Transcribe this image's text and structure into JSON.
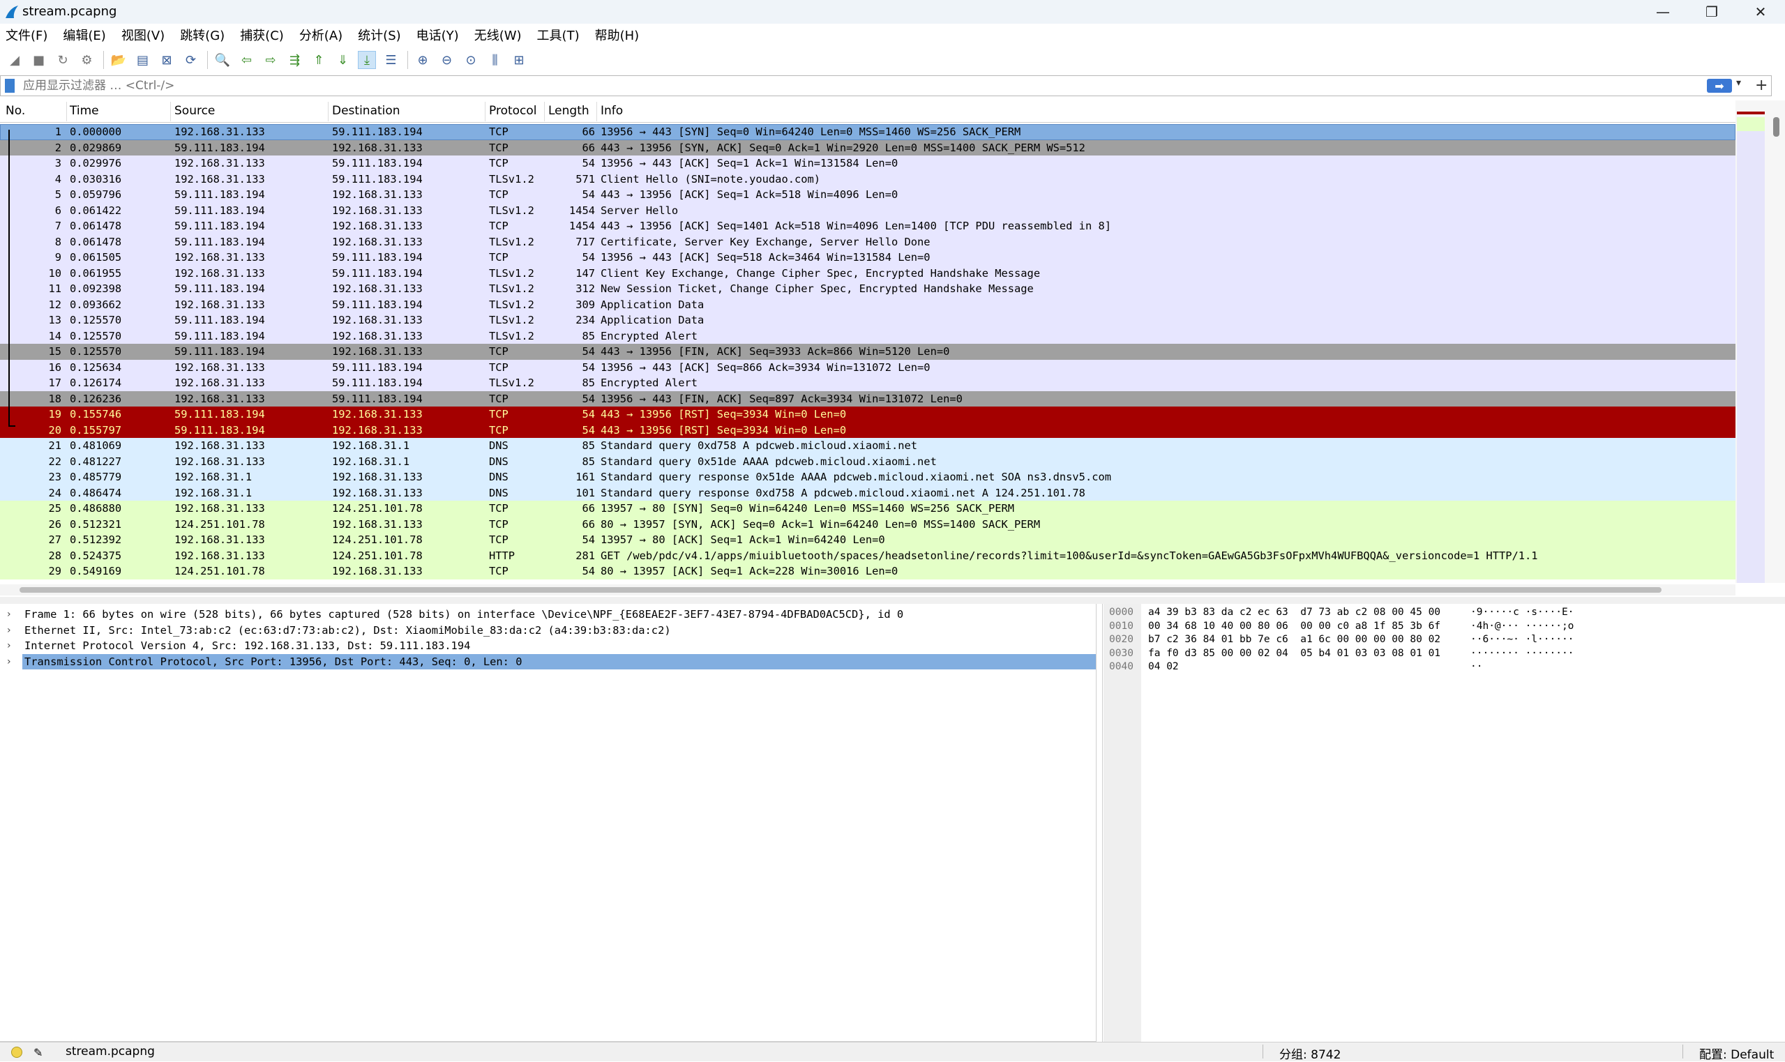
{
  "window": {
    "title": "stream.pcapng",
    "minimize": "—",
    "restore": "❐",
    "close": "✕"
  },
  "menu": [
    "文件(F)",
    "编辑(E)",
    "视图(V)",
    "跳转(G)",
    "捕获(C)",
    "分析(A)",
    "统计(S)",
    "电话(Y)",
    "无线(W)",
    "工具(T)",
    "帮助(H)"
  ],
  "toolbar": [
    {
      "name": "start-capture-icon",
      "glyph": "◢"
    },
    {
      "name": "stop-capture-icon",
      "glyph": "■"
    },
    {
      "name": "restart-capture-icon",
      "glyph": "↻"
    },
    {
      "name": "capture-options-icon",
      "glyph": "⚙"
    },
    {
      "name": "open-file-icon",
      "glyph": "📂"
    },
    {
      "name": "save-file-icon",
      "glyph": "▤"
    },
    {
      "name": "close-file-icon",
      "glyph": "⊠"
    },
    {
      "name": "reload-file-icon",
      "glyph": "⟳"
    },
    {
      "name": "find-packet-icon",
      "glyph": "🔍"
    },
    {
      "name": "go-back-icon",
      "glyph": "⇦"
    },
    {
      "name": "go-forward-icon",
      "glyph": "⇨"
    },
    {
      "name": "go-to-packet-icon",
      "glyph": "⇶"
    },
    {
      "name": "first-packet-icon",
      "glyph": "⇑"
    },
    {
      "name": "last-packet-icon",
      "glyph": "⇓"
    },
    {
      "name": "autoscroll-icon",
      "glyph": "⤓"
    },
    {
      "name": "colorize-icon",
      "glyph": "☰"
    },
    {
      "name": "zoom-in-icon",
      "glyph": "⊕"
    },
    {
      "name": "zoom-out-icon",
      "glyph": "⊖"
    },
    {
      "name": "zoom-reset-icon",
      "glyph": "⊙"
    },
    {
      "name": "resize-columns-icon",
      "glyph": "⫼"
    },
    {
      "name": "layout-icon",
      "glyph": "⊞"
    }
  ],
  "filter": {
    "placeholder": "应用显示过滤器 … <Ctrl-/>",
    "apply_glyph": "➡",
    "dropdown_glyph": "▾",
    "add_glyph": "+"
  },
  "columns": {
    "no": "No.",
    "time": "Time",
    "source": "Source",
    "destination": "Destination",
    "protocol": "Protocol",
    "length": "Length",
    "info": "Info"
  },
  "packets": [
    {
      "no": "1",
      "time": "0.000000",
      "src": "192.168.31.133",
      "dst": "59.111.183.194",
      "proto": "TCP",
      "len": "66",
      "info": "13956 → 443 [SYN] Seq=0 Win=64240 Len=0 MSS=1460 WS=256 SACK_PERM",
      "color": "tcp",
      "selected": true
    },
    {
      "no": "2",
      "time": "0.029869",
      "src": "59.111.183.194",
      "dst": "192.168.31.133",
      "proto": "TCP",
      "len": "66",
      "info": "443 → 13956 [SYN, ACK] Seq=0 Ack=1 Win=2920 Len=0 MSS=1400 SACK_PERM WS=512",
      "color": "grey"
    },
    {
      "no": "3",
      "time": "0.029976",
      "src": "192.168.31.133",
      "dst": "59.111.183.194",
      "proto": "TCP",
      "len": "54",
      "info": "13956 → 443 [ACK] Seq=1 Ack=1 Win=131584 Len=0",
      "color": "tcp"
    },
    {
      "no": "4",
      "time": "0.030316",
      "src": "192.168.31.133",
      "dst": "59.111.183.194",
      "proto": "TLSv1.2",
      "len": "571",
      "info": "Client Hello (SNI=note.youdao.com)",
      "color": "tcp"
    },
    {
      "no": "5",
      "time": "0.059796",
      "src": "59.111.183.194",
      "dst": "192.168.31.133",
      "proto": "TCP",
      "len": "54",
      "info": "443 → 13956 [ACK] Seq=1 Ack=518 Win=4096 Len=0",
      "color": "tcp"
    },
    {
      "no": "6",
      "time": "0.061422",
      "src": "59.111.183.194",
      "dst": "192.168.31.133",
      "proto": "TLSv1.2",
      "len": "1454",
      "info": "Server Hello",
      "color": "tcp"
    },
    {
      "no": "7",
      "time": "0.061478",
      "src": "59.111.183.194",
      "dst": "192.168.31.133",
      "proto": "TCP",
      "len": "1454",
      "info": "443 → 13956 [ACK] Seq=1401 Ack=518 Win=4096 Len=1400 [TCP PDU reassembled in 8]",
      "color": "tcp"
    },
    {
      "no": "8",
      "time": "0.061478",
      "src": "59.111.183.194",
      "dst": "192.168.31.133",
      "proto": "TLSv1.2",
      "len": "717",
      "info": "Certificate, Server Key Exchange, Server Hello Done",
      "color": "tcp"
    },
    {
      "no": "9",
      "time": "0.061505",
      "src": "192.168.31.133",
      "dst": "59.111.183.194",
      "proto": "TCP",
      "len": "54",
      "info": "13956 → 443 [ACK] Seq=518 Ack=3464 Win=131584 Len=0",
      "color": "tcp"
    },
    {
      "no": "10",
      "time": "0.061955",
      "src": "192.168.31.133",
      "dst": "59.111.183.194",
      "proto": "TLSv1.2",
      "len": "147",
      "info": "Client Key Exchange, Change Cipher Spec, Encrypted Handshake Message",
      "color": "tcp"
    },
    {
      "no": "11",
      "time": "0.092398",
      "src": "59.111.183.194",
      "dst": "192.168.31.133",
      "proto": "TLSv1.2",
      "len": "312",
      "info": "New Session Ticket, Change Cipher Spec, Encrypted Handshake Message",
      "color": "tcp"
    },
    {
      "no": "12",
      "time": "0.093662",
      "src": "192.168.31.133",
      "dst": "59.111.183.194",
      "proto": "TLSv1.2",
      "len": "309",
      "info": "Application Data",
      "color": "tcp"
    },
    {
      "no": "13",
      "time": "0.125570",
      "src": "59.111.183.194",
      "dst": "192.168.31.133",
      "proto": "TLSv1.2",
      "len": "234",
      "info": "Application Data",
      "color": "tcp"
    },
    {
      "no": "14",
      "time": "0.125570",
      "src": "59.111.183.194",
      "dst": "192.168.31.133",
      "proto": "TLSv1.2",
      "len": "85",
      "info": "Encrypted Alert",
      "color": "tcp"
    },
    {
      "no": "15",
      "time": "0.125570",
      "src": "59.111.183.194",
      "dst": "192.168.31.133",
      "proto": "TCP",
      "len": "54",
      "info": "443 → 13956 [FIN, ACK] Seq=3933 Ack=866 Win=5120 Len=0",
      "color": "grey"
    },
    {
      "no": "16",
      "time": "0.125634",
      "src": "192.168.31.133",
      "dst": "59.111.183.194",
      "proto": "TCP",
      "len": "54",
      "info": "13956 → 443 [ACK] Seq=866 Ack=3934 Win=131072 Len=0",
      "color": "tcp"
    },
    {
      "no": "17",
      "time": "0.126174",
      "src": "192.168.31.133",
      "dst": "59.111.183.194",
      "proto": "TLSv1.2",
      "len": "85",
      "info": "Encrypted Alert",
      "color": "tcp"
    },
    {
      "no": "18",
      "time": "0.126236",
      "src": "192.168.31.133",
      "dst": "59.111.183.194",
      "proto": "TCP",
      "len": "54",
      "info": "13956 → 443 [FIN, ACK] Seq=897 Ack=3934 Win=131072 Len=0",
      "color": "grey"
    },
    {
      "no": "19",
      "time": "0.155746",
      "src": "59.111.183.194",
      "dst": "192.168.31.133",
      "proto": "TCP",
      "len": "54",
      "info": "443 → 13956 [RST] Seq=3934 Win=0 Len=0",
      "color": "rst"
    },
    {
      "no": "20",
      "time": "0.155797",
      "src": "59.111.183.194",
      "dst": "192.168.31.133",
      "proto": "TCP",
      "len": "54",
      "info": "443 → 13956 [RST] Seq=3934 Win=0 Len=0",
      "color": "rst"
    },
    {
      "no": "21",
      "time": "0.481069",
      "src": "192.168.31.133",
      "dst": "192.168.31.1",
      "proto": "DNS",
      "len": "85",
      "info": "Standard query 0xd758 A pdcweb.micloud.xiaomi.net",
      "color": "dns"
    },
    {
      "no": "22",
      "time": "0.481227",
      "src": "192.168.31.133",
      "dst": "192.168.31.1",
      "proto": "DNS",
      "len": "85",
      "info": "Standard query 0x51de AAAA pdcweb.micloud.xiaomi.net",
      "color": "dns"
    },
    {
      "no": "23",
      "time": "0.485779",
      "src": "192.168.31.1",
      "dst": "192.168.31.133",
      "proto": "DNS",
      "len": "161",
      "info": "Standard query response 0x51de AAAA pdcweb.micloud.xiaomi.net SOA ns3.dnsv5.com",
      "color": "dns"
    },
    {
      "no": "24",
      "time": "0.486474",
      "src": "192.168.31.1",
      "dst": "192.168.31.133",
      "proto": "DNS",
      "len": "101",
      "info": "Standard query response 0xd758 A pdcweb.micloud.xiaomi.net A 124.251.101.78",
      "color": "dns"
    },
    {
      "no": "25",
      "time": "0.486880",
      "src": "192.168.31.133",
      "dst": "124.251.101.78",
      "proto": "TCP",
      "len": "66",
      "info": "13957 → 80 [SYN] Seq=0 Win=64240 Len=0 MSS=1460 WS=256 SACK_PERM",
      "color": "http"
    },
    {
      "no": "26",
      "time": "0.512321",
      "src": "124.251.101.78",
      "dst": "192.168.31.133",
      "proto": "TCP",
      "len": "66",
      "info": "80 → 13957 [SYN, ACK] Seq=0 Ack=1 Win=64240 Len=0 MSS=1400 SACK_PERM",
      "color": "http"
    },
    {
      "no": "27",
      "time": "0.512392",
      "src": "192.168.31.133",
      "dst": "124.251.101.78",
      "proto": "TCP",
      "len": "54",
      "info": "13957 → 80 [ACK] Seq=1 Ack=1 Win=64240 Len=0",
      "color": "http"
    },
    {
      "no": "28",
      "time": "0.524375",
      "src": "192.168.31.133",
      "dst": "124.251.101.78",
      "proto": "HTTP",
      "len": "281",
      "info": "GET /web/pdc/v4.1/apps/miuibluetooth/spaces/headsetonline/records?limit=100&userId=&syncToken=GAEwGA5Gb3FsOFpxMVh4WUFBQQA&_versioncode=1 HTTP/1.1",
      "color": "http"
    },
    {
      "no": "29",
      "time": "0.549169",
      "src": "124.251.101.78",
      "dst": "192.168.31.133",
      "proto": "TCP",
      "len": "54",
      "info": "80 → 13957 [ACK] Seq=1 Ack=228 Win=30016 Len=0",
      "color": "http"
    }
  ],
  "details": [
    {
      "text": "Frame 1: 66 bytes on wire (528 bits), 66 bytes captured (528 bits) on interface \\Device\\NPF_{E68EAE2F-3EF7-43E7-8794-4DFBAD0AC5CD}, id 0"
    },
    {
      "text": "Ethernet II, Src: Intel_73:ab:c2 (ec:63:d7:73:ab:c2), Dst: XiaomiMobile_83:da:c2 (a4:39:b3:83:da:c2)"
    },
    {
      "text": "Internet Protocol Version 4, Src: 192.168.31.133, Dst: 59.111.183.194"
    },
    {
      "text": "Transmission Control Protocol, Src Port: 13956, Dst Port: 443, Seq: 0, Len: 0",
      "selected": true
    }
  ],
  "details_arrow": "›",
  "bytes": [
    {
      "offset": "0000",
      "hex": "a4 39 b3 83 da c2 ec 63  d7 73 ab c2 08 00 45 00",
      "ascii": "·9·····c ·s····E·"
    },
    {
      "offset": "0010",
      "hex": "00 34 68 10 40 00 80 06  00 00 c0 a8 1f 85 3b 6f",
      "ascii": "·4h·@··· ······;o"
    },
    {
      "offset": "0020",
      "hex": "b7 c2 36 84 01 bb 7e c6  a1 6c 00 00 00 00 80 02",
      "ascii": "··6···~· ·l······"
    },
    {
      "offset": "0030",
      "hex": "fa f0 d3 85 00 00 02 04  05 b4 01 03 03 08 01 01",
      "ascii": "········ ········"
    },
    {
      "offset": "0040",
      "hex": "04 02",
      "ascii": "··"
    }
  ],
  "status": {
    "file": "stream.pcapng",
    "packets": "分组: 8742",
    "profile": "配置: Default"
  },
  "colors": {
    "tcp": "#e7e6ff",
    "grey": "#a0a0a0",
    "rst": "#a40000",
    "rst_text": "#fffc9c",
    "dns": "#daeeff",
    "http": "#e4ffc7",
    "selected": "#82aee0"
  }
}
